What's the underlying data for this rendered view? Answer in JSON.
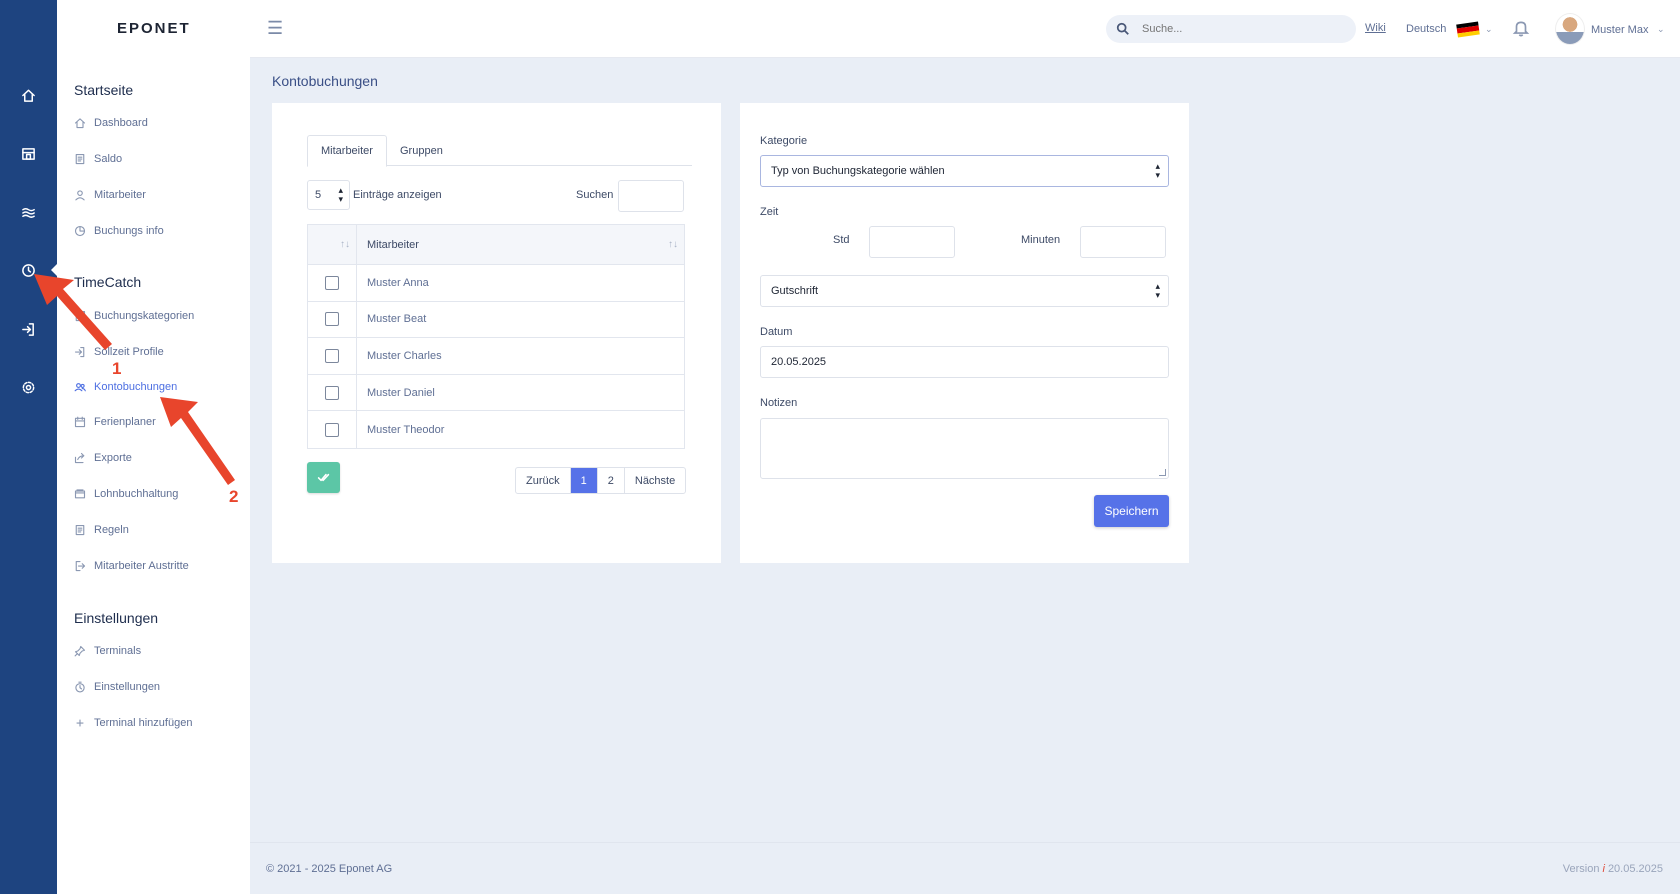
{
  "brand": {
    "logo_text": "EPONET"
  },
  "rail": {
    "icons": [
      "home-icon",
      "store-icon",
      "waves-icon",
      "clock-icon",
      "login-icon",
      "gear-icon"
    ]
  },
  "sidebar": {
    "section_start": "Startseite",
    "start_items": [
      {
        "label": "Dashboard",
        "icon": "home-icon"
      },
      {
        "label": "Saldo",
        "icon": "document-icon"
      },
      {
        "label": "Mitarbeiter",
        "icon": "user-icon"
      },
      {
        "label": "Buchungs info",
        "icon": "chart-icon"
      }
    ],
    "section_timecatch": "TimeCatch",
    "timecatch_items": [
      {
        "label": "Buchungskategorien",
        "icon": "copy-icon"
      },
      {
        "label": "Sollzeit Profile",
        "icon": "login-icon"
      },
      {
        "label": "Kontobuchungen",
        "icon": "users-icon",
        "active": true
      },
      {
        "label": "Ferienplaner",
        "icon": "calendar-icon"
      },
      {
        "label": "Exporte",
        "icon": "share-icon"
      },
      {
        "label": "Lohnbuchhaltung",
        "icon": "wallet-icon"
      },
      {
        "label": "Regeln",
        "icon": "document-icon"
      },
      {
        "label": "Mitarbeiter Austritte",
        "icon": "exit-icon"
      }
    ],
    "section_settings": "Einstellungen",
    "settings_items": [
      {
        "label": "Terminals",
        "icon": "pin-icon"
      },
      {
        "label": "Einstellungen",
        "icon": "stopwatch-icon"
      },
      {
        "label": "Terminal hinzufügen",
        "icon": "plus-icon"
      }
    ]
  },
  "header": {
    "search_placeholder": "Suche...",
    "wiki": "Wiki",
    "language": "Deutsch",
    "flag_colors": [
      "#000000",
      "#dd0000",
      "#ffce00"
    ],
    "user_name": "Muster Max"
  },
  "main": {
    "page_title": "Kontobuchungen",
    "tabs": [
      "Mitarbeiter",
      "Gruppen"
    ],
    "entries_value": "5",
    "entries_label": "Einträge anzeigen",
    "search_label": "Suchen",
    "table": {
      "column": "Mitarbeiter",
      "rows": [
        "Muster Anna",
        "Muster Beat",
        "Muster Charles",
        "Muster Daniel",
        "Muster Theodor"
      ]
    },
    "pager": {
      "prev": "Zurück",
      "pages": [
        "1",
        "2"
      ],
      "next": "Nächste",
      "current": "1"
    }
  },
  "form": {
    "kategorie_label": "Kategorie",
    "kategorie_value": "Typ von Buchungskategorie wählen",
    "zeit_label": "Zeit",
    "std_label": "Std",
    "minuten_label": "Minuten",
    "type_value": "Gutschrift",
    "datum_label": "Datum",
    "datum_value": "20.05.2025",
    "notizen_label": "Notizen",
    "save_label": "Speichern"
  },
  "footer": {
    "copyright": "© 2021 - 2025 Eponet AG",
    "version_label": "Version",
    "version_icon": "i",
    "version_date": "20.05.2025"
  },
  "annotations": {
    "label_1": "1",
    "label_2": "2",
    "color": "#e8452c"
  }
}
